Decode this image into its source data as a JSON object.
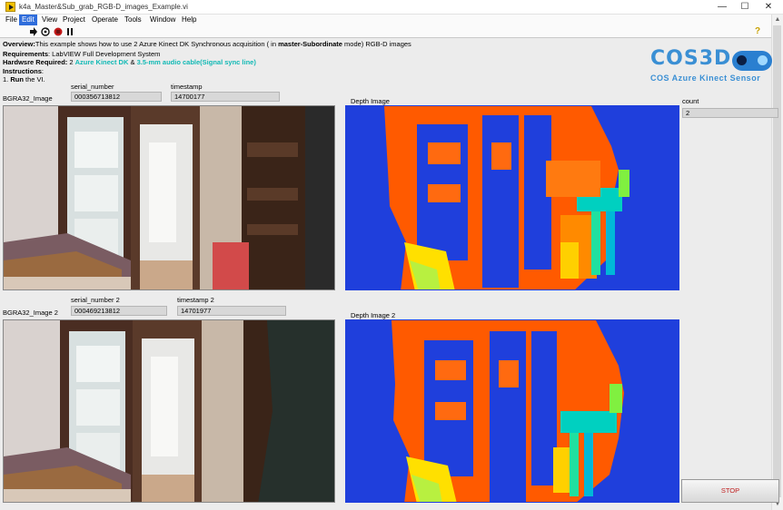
{
  "window": {
    "title": "k4a_Master&Sub_grab_RGB-D_images_Example.vi",
    "minimize": "—",
    "maximize": "☐",
    "close": "✕"
  },
  "menu": {
    "items": [
      "File",
      "Edit",
      "View",
      "Project",
      "Operate",
      "Tools",
      "Window",
      "Help"
    ],
    "active": "Edit"
  },
  "toolbar": {
    "run_icon": "run-arrow-icon",
    "run_continuously_icon": "run-continuously-icon",
    "abort_icon": "abort-icon",
    "pause_icon": "pause-icon",
    "help_icon": "context-help-icon"
  },
  "description": {
    "overview_label": "Overview:",
    "overview_text_1": "This example shows how to use  2 Azure Kinect DK  Synchronous acquisition ( in  ",
    "overview_bold": "master-Subordinate",
    "overview_text_2": " mode) RGB-D images",
    "requirements_label": "Requirements",
    "requirements_text": ": LabVIEW Full Development System",
    "hardware_label": "Hardwsre Required:",
    "hardware_text_1": " 2 ",
    "hardware_cyan_1": "Azure Kinect DK",
    "hardware_text_2": " & ",
    "hardware_cyan_2": "3.5-mm audio cable(Signal sync line)",
    "instructions_label": "Instructions",
    "instructions_colon": ":",
    "step1_num": "1. ",
    "step1_bold": "Run",
    "step1_text": " the VI."
  },
  "logo": {
    "text": "COS3D",
    "subtitle": "COS Azure Kinect Sensor"
  },
  "camera1": {
    "image_label": "BGRA32_Image",
    "serial_label": "serial_number",
    "serial_value": "000356713812",
    "timestamp_label": "timestamp",
    "timestamp_value": "14700177",
    "depth_label": "Depth Image"
  },
  "camera2": {
    "image_label": "BGRA32_Image 2",
    "serial_label": "serial_number 2",
    "serial_value": "000469213812",
    "timestamp_label": "timestamp 2",
    "timestamp_value": "14701977",
    "depth_label": "Depth Image 2"
  },
  "count": {
    "label": "count",
    "value": "2"
  },
  "stop_button": "STOP",
  "colors": {
    "depth_background": "#1f3fdc",
    "depth_near": "#ff5a00",
    "depth_mid": "#00d0c0",
    "accent_cyan": "#11b9b5",
    "logo_blue": "#3a8fd4"
  }
}
